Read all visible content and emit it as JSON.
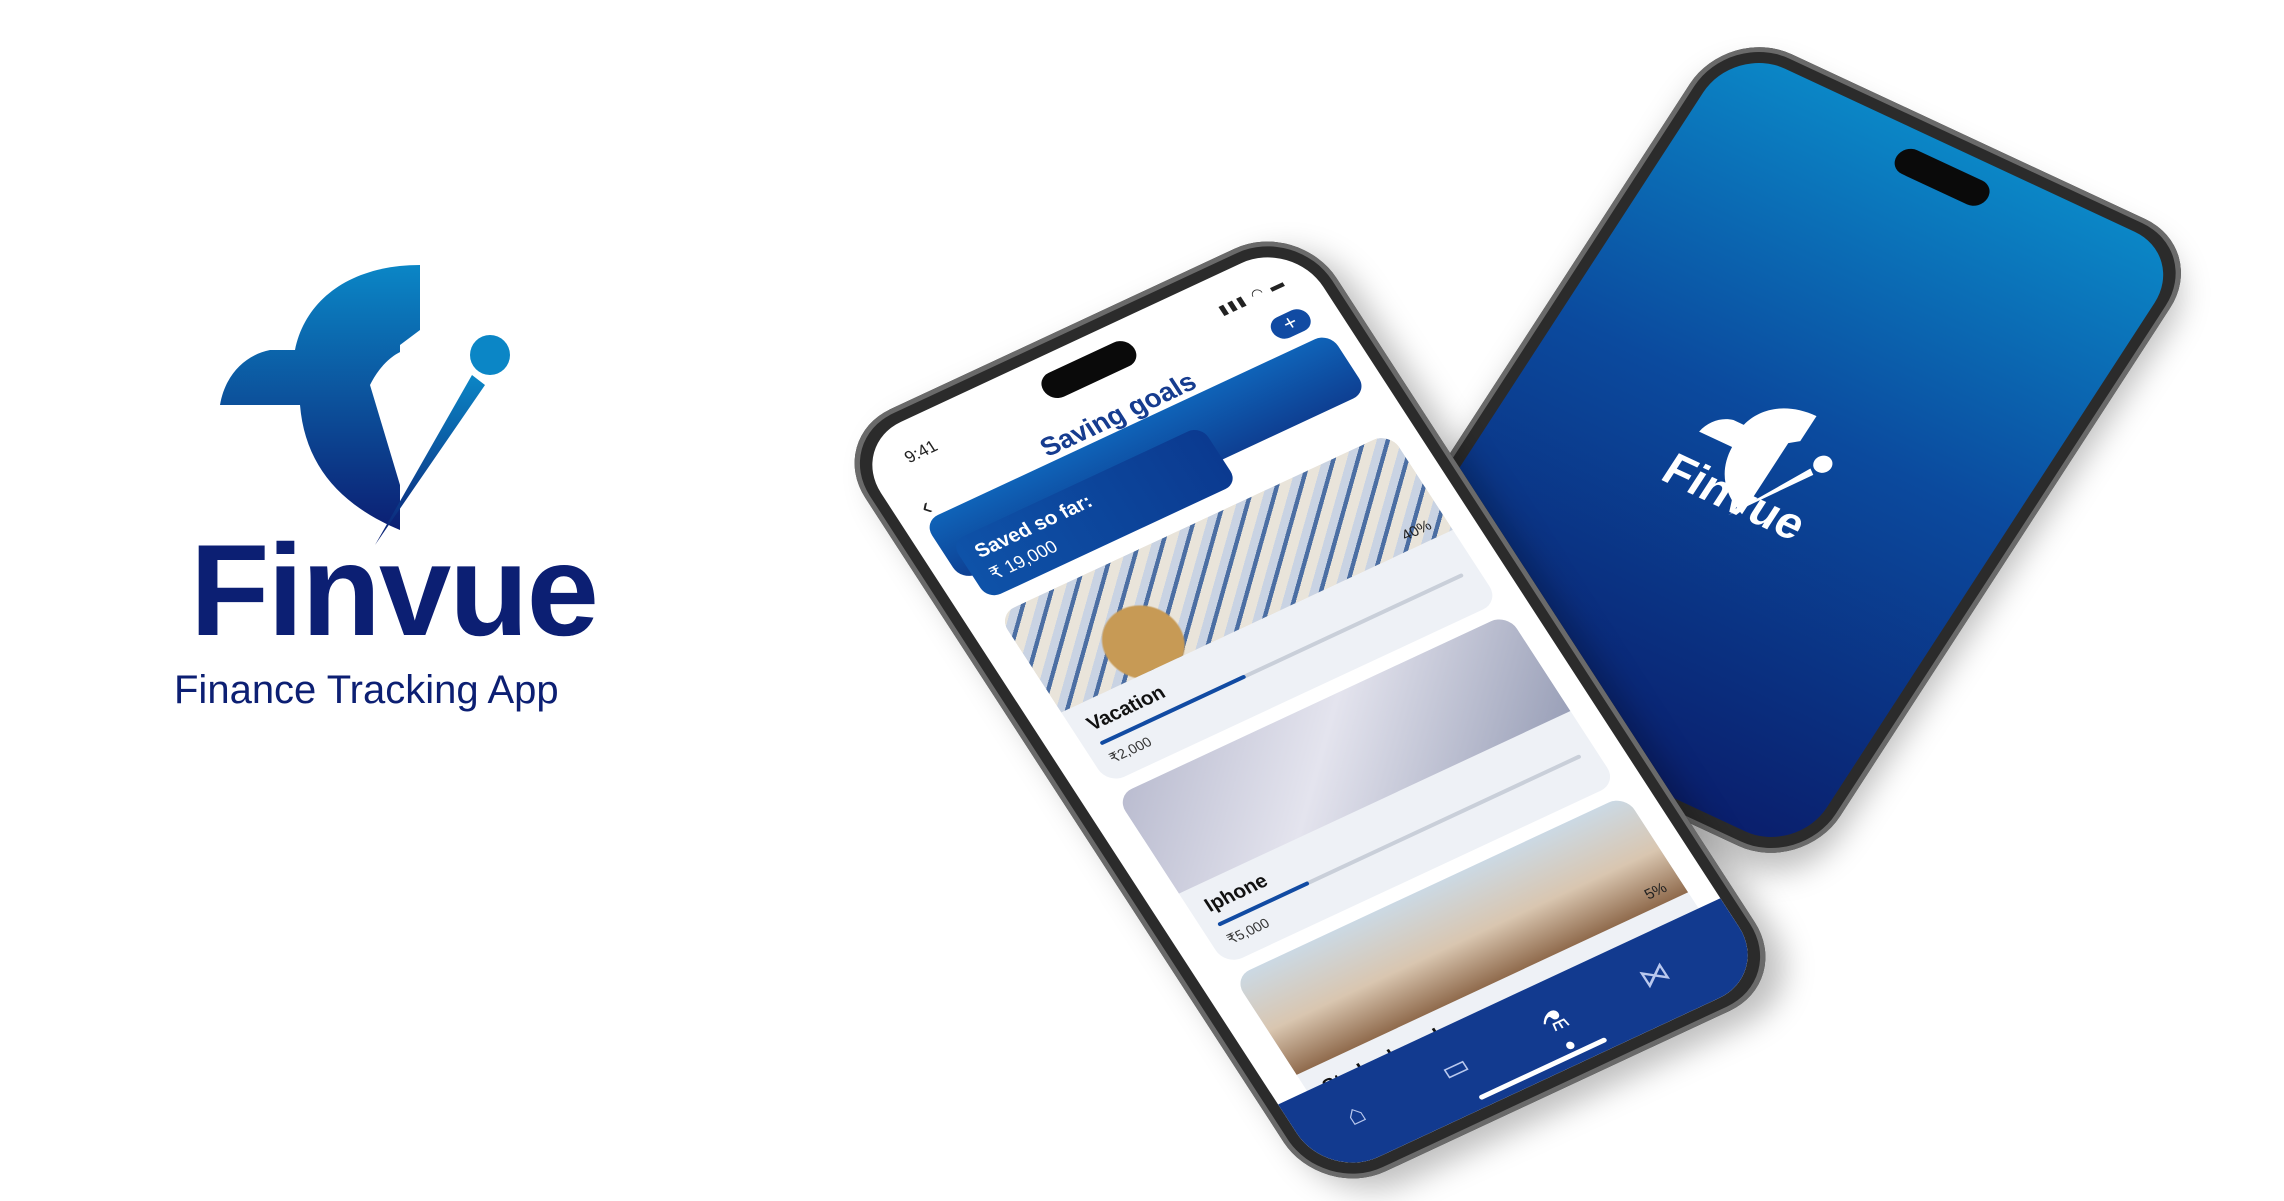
{
  "brand": {
    "name": "Finvue",
    "tagline": "Finance Tracking App",
    "colors": {
      "primary": "#0c1f73",
      "accent": "#0b86c6"
    }
  },
  "splash_screen": {
    "name": "Finvue",
    "gradient": [
      "#0b86c6",
      "#0a1f6d"
    ]
  },
  "app_screen": {
    "status": {
      "time": "9:41",
      "icons": [
        "signal-icon",
        "wifi-icon",
        "battery-icon"
      ]
    },
    "title": "Saving goals",
    "add_label": "+",
    "saved": {
      "label": "Saved so far:",
      "amount": "₹ 19,000"
    },
    "goals": [
      {
        "name": "Vacation",
        "amount": "₹2,000",
        "percent": "40%",
        "progress": 0.4,
        "photo": "beach-photo"
      },
      {
        "name": "Iphone",
        "amount": "₹5,000",
        "percent": "",
        "progress": 0.25,
        "photo": "iphone-photo"
      },
      {
        "name": "Study abroad",
        "amount": "",
        "percent": "5%",
        "progress": 0.05,
        "photo": "city-photo"
      }
    ],
    "nav": [
      "home-icon",
      "wallet-icon",
      "savings-icon",
      "network-icon"
    ]
  }
}
